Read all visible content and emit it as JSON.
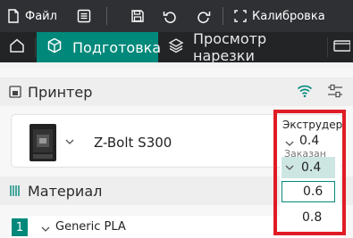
{
  "toolbar": {
    "file_label": "Файл",
    "calibration_label": "Калибровка"
  },
  "tabs": {
    "prepare_label": "Подготовка",
    "preview_label": "Просмотр нарезки"
  },
  "printer_section": {
    "title": "Принтер",
    "printer_name": "Z-Bolt S300"
  },
  "extruder": {
    "label": "Экструдер",
    "current_value": "0.4",
    "sub_label": "Заказан",
    "options": [
      "0.4",
      "0.6",
      "0.8"
    ],
    "selected_option": "0.4"
  },
  "material_section": {
    "title": "Материал",
    "items": [
      {
        "index": "1",
        "name": "Generic PLA"
      }
    ]
  },
  "colors": {
    "accent": "#00897b",
    "highlight_frame": "#e01b24",
    "topbar_bg": "#2e3033",
    "tabbar_bg": "#222426"
  }
}
